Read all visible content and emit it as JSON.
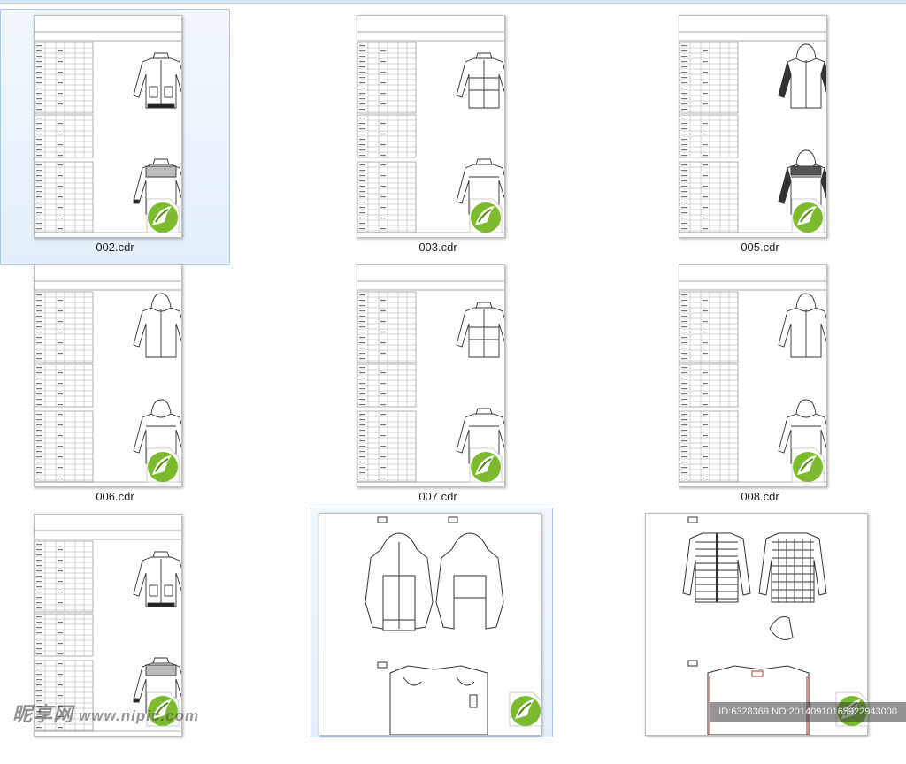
{
  "window": {
    "selection_color": "#e4effb"
  },
  "files": [
    {
      "name": "002.cdr",
      "kind": "spec",
      "jacket": "pocket-jacket",
      "selected": true
    },
    {
      "name": "003.cdr",
      "kind": "spec",
      "jacket": "stripe-jacket",
      "selected": false
    },
    {
      "name": "005.cdr",
      "kind": "spec",
      "jacket": "hood-dark",
      "selected": false
    },
    {
      "name": "006.cdr",
      "kind": "spec",
      "jacket": "hood-light",
      "selected": false
    },
    {
      "name": "007.cdr",
      "kind": "spec",
      "jacket": "panel-jacket",
      "selected": false
    },
    {
      "name": "008.cdr",
      "kind": "spec",
      "jacket": "hood-zip",
      "selected": false
    },
    {
      "name": "",
      "kind": "spec",
      "jacket": "pocket-jacket-2",
      "selected": false
    },
    {
      "name": "",
      "kind": "drawing-hood",
      "jacket": "hood-drawing",
      "selected": true
    },
    {
      "name": "",
      "kind": "drawing-quilt",
      "jacket": "quilt-drawing",
      "selected": false
    }
  ],
  "icons": {
    "cdr": "coreldraw-file-icon"
  },
  "colors": {
    "cdr_green": "#7dbb2e",
    "cdr_dark": "#4f8a12"
  },
  "watermark": {
    "logo_text": "昵享网",
    "site": "www.nipic.com",
    "id_text": "ID:6328369 NO:20140910165922943000"
  }
}
